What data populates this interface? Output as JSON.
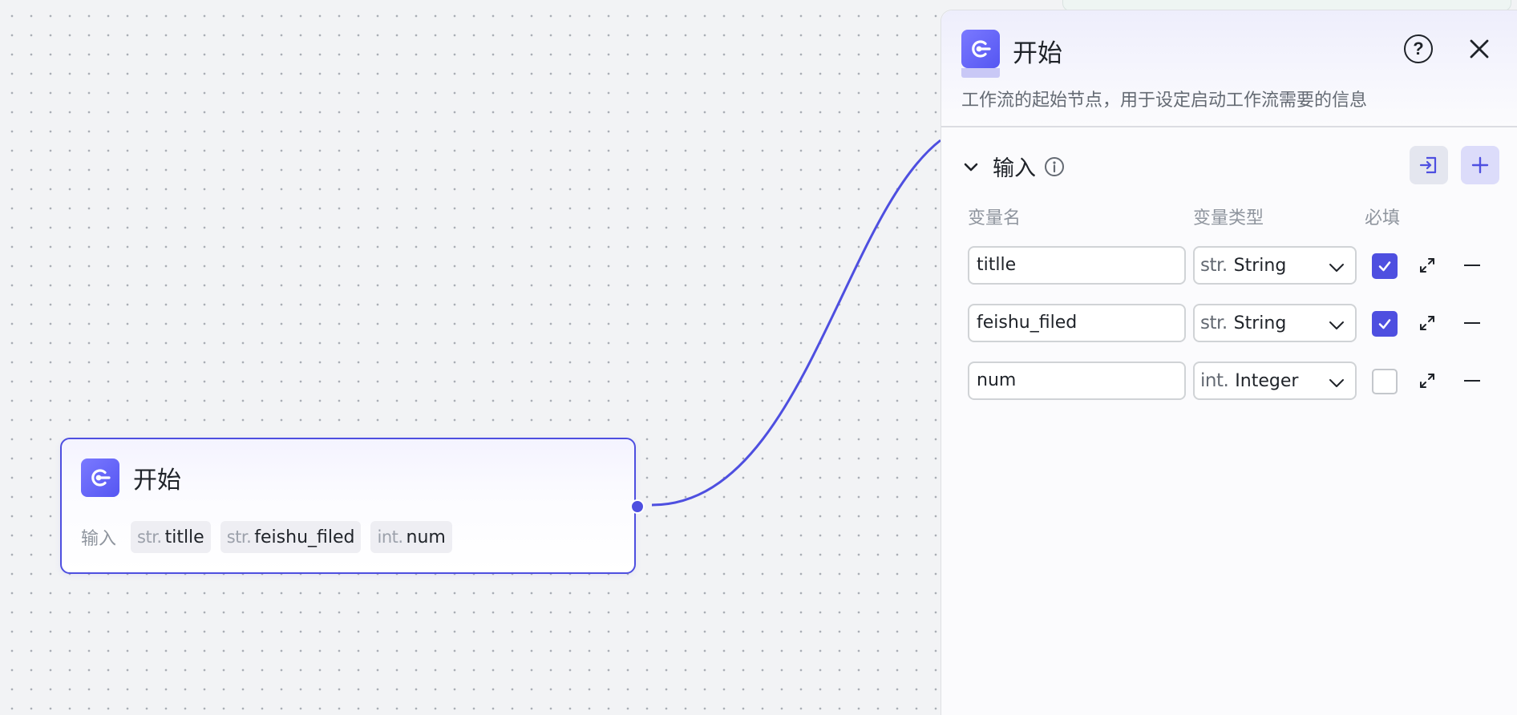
{
  "canvas": {
    "start_node": {
      "title": "开始",
      "inputs_label": "输入",
      "tags": [
        {
          "type": "str.",
          "name": "titlle"
        },
        {
          "type": "str.",
          "name": "feishu_filed"
        },
        {
          "type": "int.",
          "name": "num"
        }
      ]
    }
  },
  "panel": {
    "title": "开始",
    "description": "工作流的起始节点，用于设定启动工作流需要的信息",
    "help_icon": "question-circle-icon",
    "close_icon": "close-icon",
    "section": {
      "title": "输入",
      "info_icon": "info-icon",
      "import_icon": "import-icon",
      "add_icon": "plus-icon"
    },
    "columns": {
      "name": "变量名",
      "type": "变量类型",
      "required": "必填"
    },
    "variables": [
      {
        "name": "titlle",
        "type_prefix": "str.",
        "type_label": "String",
        "required": true
      },
      {
        "name": "feishu_filed",
        "type_prefix": "str.",
        "type_label": "String",
        "required": true
      },
      {
        "name": "num",
        "type_prefix": "int.",
        "type_label": "Integer",
        "required": false
      }
    ]
  },
  "colors": {
    "accent": "#4e4fe0",
    "node_icon": "#6463f7",
    "canvas_bg": "#f2f3f5"
  }
}
